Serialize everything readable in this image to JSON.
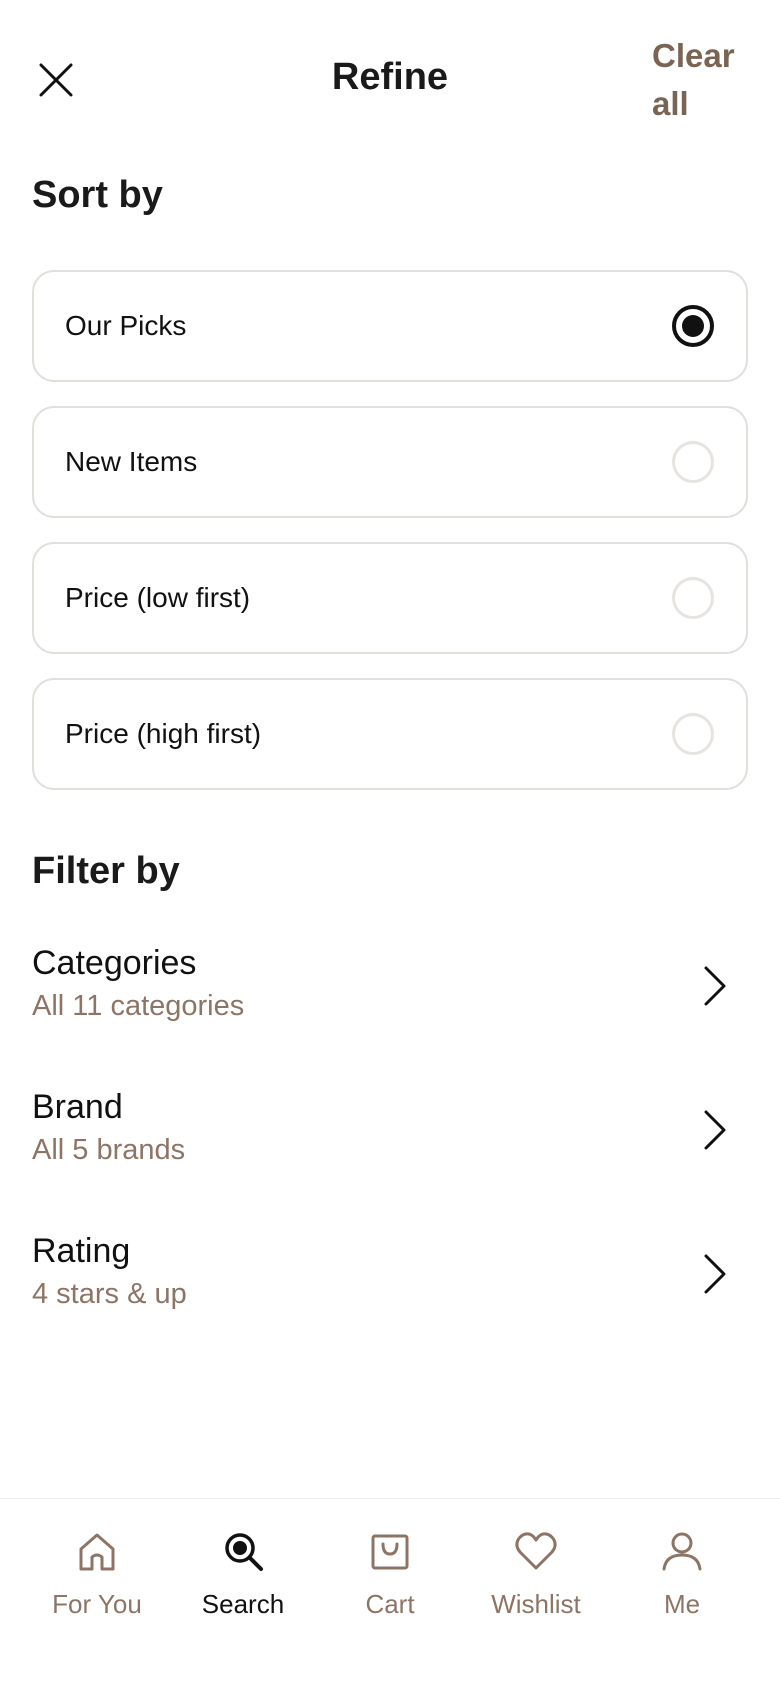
{
  "header": {
    "title": "Refine",
    "clear_all_label": "Clear all",
    "close_icon": "close-icon"
  },
  "sort": {
    "heading": "Sort by",
    "options": [
      {
        "label": "Our Picks",
        "selected": true
      },
      {
        "label": "New Items",
        "selected": false
      },
      {
        "label": "Price (low first)",
        "selected": false
      },
      {
        "label": "Price (high first)",
        "selected": false
      }
    ]
  },
  "filter": {
    "heading": "Filter by",
    "rows": [
      {
        "title": "Categories",
        "subtitle": "All 11 categories"
      },
      {
        "title": "Brand",
        "subtitle": "All 5 brands"
      },
      {
        "title": "Rating",
        "subtitle": "4 stars & up"
      }
    ]
  },
  "nav": {
    "items": [
      {
        "label": "For You",
        "icon": "home-icon",
        "active": false
      },
      {
        "label": "Search",
        "icon": "search-icon",
        "active": true
      },
      {
        "label": "Cart",
        "icon": "bag-icon",
        "active": false
      },
      {
        "label": "Wishlist",
        "icon": "heart-icon",
        "active": false
      },
      {
        "label": "Me",
        "icon": "person-icon",
        "active": false
      }
    ]
  },
  "colors": {
    "accent": "#7a6453",
    "muted": "#8c7566",
    "border": "#e2dedb",
    "text": "#111111"
  }
}
